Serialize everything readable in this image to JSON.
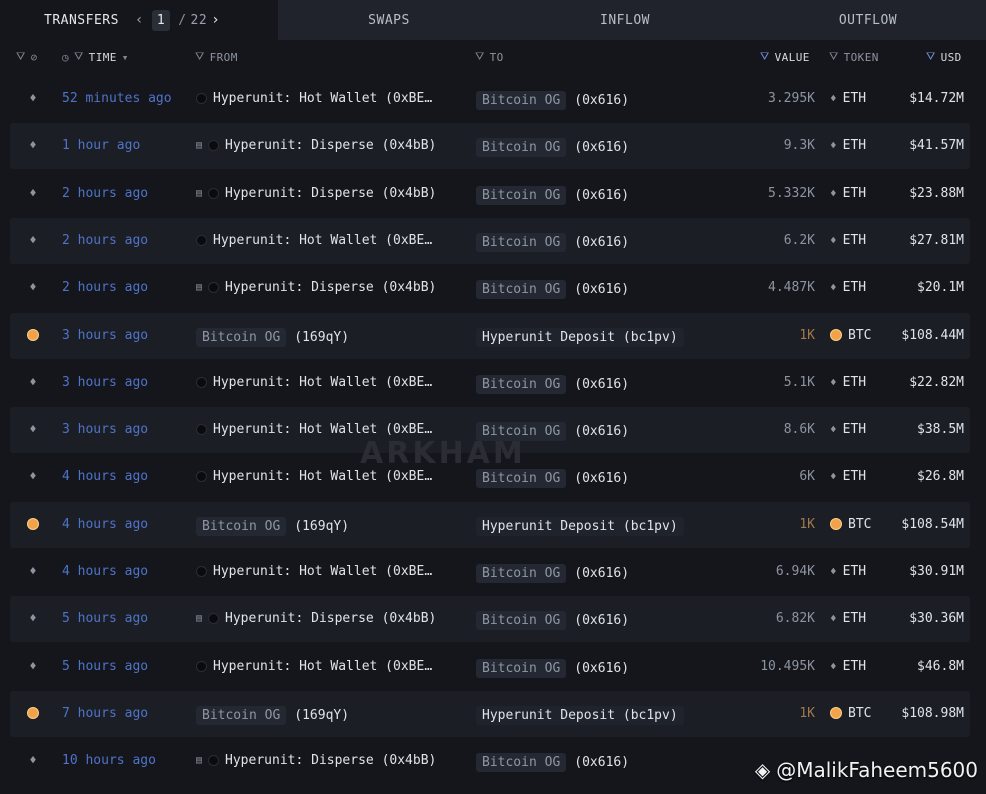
{
  "tabs": {
    "transfers": "TRANSFERS",
    "swaps": "SWAPS",
    "inflow": "INFLOW",
    "outflow": "OUTFLOW"
  },
  "pager": {
    "current": "1",
    "separator": "/",
    "total": "22"
  },
  "columns": {
    "time": "TIME",
    "from": "FROM",
    "to": "TO",
    "value": "VALUE",
    "token": "TOKEN",
    "usd": "USD"
  },
  "rows": [
    {
      "chain": "eth",
      "time": "52 minutes ago",
      "from_name": "Hyperunit: Hot Wallet (0xBE…",
      "from_type": "entity",
      "to_name": "Bitcoin OG",
      "to_addr": "(0x616)",
      "value": "3.295K",
      "token": "ETH",
      "usd": "$14.72M"
    },
    {
      "chain": "eth",
      "time": "1 hour ago",
      "from_name": "Hyperunit: Disperse (0x4bB)",
      "from_type": "contract",
      "to_name": "Bitcoin OG",
      "to_addr": "(0x616)",
      "value": "9.3K",
      "token": "ETH",
      "usd": "$41.57M"
    },
    {
      "chain": "eth",
      "time": "2 hours ago",
      "from_name": "Hyperunit: Disperse (0x4bB)",
      "from_type": "contract",
      "to_name": "Bitcoin OG",
      "to_addr": "(0x616)",
      "value": "5.332K",
      "token": "ETH",
      "usd": "$23.88M"
    },
    {
      "chain": "eth",
      "time": "2 hours ago",
      "from_name": "Hyperunit: Hot Wallet (0xBE…",
      "from_type": "entity",
      "to_name": "Bitcoin OG",
      "to_addr": "(0x616)",
      "value": "6.2K",
      "token": "ETH",
      "usd": "$27.81M"
    },
    {
      "chain": "eth",
      "time": "2 hours ago",
      "from_name": "Hyperunit: Disperse (0x4bB)",
      "from_type": "contract",
      "to_name": "Bitcoin OG",
      "to_addr": "(0x616)",
      "value": "4.487K",
      "token": "ETH",
      "usd": "$20.1M"
    },
    {
      "chain": "btc",
      "time": "3 hours ago",
      "from_name": "Bitcoin OG",
      "from_addr": "(169qY)",
      "from_type": "pill",
      "to_name": "Hyperunit Deposit (bc1pv)",
      "to_addr": "",
      "value": "1K",
      "token": "BTC",
      "usd": "$108.44M"
    },
    {
      "chain": "eth",
      "time": "3 hours ago",
      "from_name": "Hyperunit: Hot Wallet (0xBE…",
      "from_type": "entity",
      "to_name": "Bitcoin OG",
      "to_addr": "(0x616)",
      "value": "5.1K",
      "token": "ETH",
      "usd": "$22.82M"
    },
    {
      "chain": "eth",
      "time": "3 hours ago",
      "from_name": "Hyperunit: Hot Wallet (0xBE…",
      "from_type": "entity",
      "to_name": "Bitcoin OG",
      "to_addr": "(0x616)",
      "value": "8.6K",
      "token": "ETH",
      "usd": "$38.5M"
    },
    {
      "chain": "eth",
      "time": "4 hours ago",
      "from_name": "Hyperunit: Hot Wallet (0xBE…",
      "from_type": "entity",
      "to_name": "Bitcoin OG",
      "to_addr": "(0x616)",
      "value": "6K",
      "token": "ETH",
      "usd": "$26.8M"
    },
    {
      "chain": "btc",
      "time": "4 hours ago",
      "from_name": "Bitcoin OG",
      "from_addr": "(169qY)",
      "from_type": "pill",
      "to_name": "Hyperunit Deposit (bc1pv)",
      "to_addr": "",
      "value": "1K",
      "token": "BTC",
      "usd": "$108.54M"
    },
    {
      "chain": "eth",
      "time": "4 hours ago",
      "from_name": "Hyperunit: Hot Wallet (0xBE…",
      "from_type": "entity",
      "to_name": "Bitcoin OG",
      "to_addr": "(0x616)",
      "value": "6.94K",
      "token": "ETH",
      "usd": "$30.91M"
    },
    {
      "chain": "eth",
      "time": "5 hours ago",
      "from_name": "Hyperunit: Disperse (0x4bB)",
      "from_type": "contract",
      "to_name": "Bitcoin OG",
      "to_addr": "(0x616)",
      "value": "6.82K",
      "token": "ETH",
      "usd": "$30.36M"
    },
    {
      "chain": "eth",
      "time": "5 hours ago",
      "from_name": "Hyperunit: Hot Wallet (0xBE…",
      "from_type": "entity",
      "to_name": "Bitcoin OG",
      "to_addr": "(0x616)",
      "value": "10.495K",
      "token": "ETH",
      "usd": "$46.8M"
    },
    {
      "chain": "btc",
      "time": "7 hours ago",
      "from_name": "Bitcoin OG",
      "from_addr": "(169qY)",
      "from_type": "pill",
      "to_name": "Hyperunit Deposit (bc1pv)",
      "to_addr": "",
      "value": "1K",
      "token": "BTC",
      "usd": "$108.98M"
    },
    {
      "chain": "eth",
      "time": "10 hours ago",
      "from_name": "Hyperunit: Disperse (0x4bB)",
      "from_type": "contract",
      "to_name": "Bitcoin OG",
      "to_addr": "(0x616)",
      "value": "",
      "token": "",
      "usd": ""
    }
  ],
  "watermark": "ARKHAM",
  "credit": "@MalikFaheem5600"
}
